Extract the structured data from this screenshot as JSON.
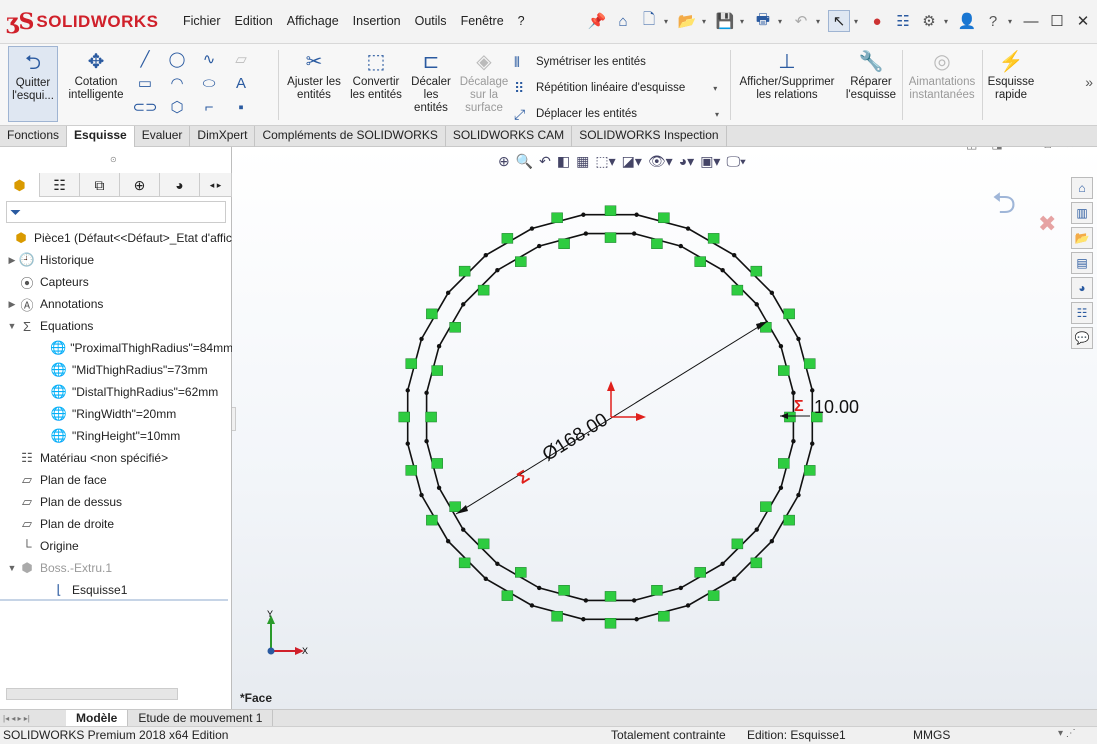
{
  "app": {
    "logo_prefix": "3DS",
    "logo_text": "SOLIDWORKS"
  },
  "menu": [
    "Fichier",
    "Edition",
    "Affichage",
    "Insertion",
    "Outils",
    "Fenêtre",
    "?"
  ],
  "quickbar_icons": [
    "pin-icon",
    "home-icon",
    "new-file-icon",
    "open-icon",
    "save-icon",
    "print-icon",
    "undo-icon",
    "select-icon",
    "traffic-light-icon",
    "options-icon",
    "gear-icon",
    "user-icon",
    "help-icon",
    "minimize-icon",
    "maximize-icon",
    "close-icon"
  ],
  "commands": {
    "quitter": "Quitter l'esqui...",
    "cotation": "Cotation intelligente",
    "ajuster": "Ajuster les entités",
    "convertir": "Convertir les entités",
    "decaler": "Décaler les entités",
    "decalage_surface": "Décalage sur la surface",
    "symetriser": "Symétriser les entités",
    "repetition": "Répétition linéaire d'esquisse",
    "deplacer": "Déplacer les entités",
    "afficher_relations": "Afficher/Supprimer les relations",
    "reparer": "Réparer l'esquisse",
    "aimantations": "Aimantations instantanées",
    "esquisse_rapide": "Esquisse rapide"
  },
  "tabs": [
    "Fonctions",
    "Esquisse",
    "Evaluer",
    "DimXpert",
    "Compléments de SOLIDWORKS",
    "SOLIDWORKS CAM",
    "SOLIDWORKS Inspection"
  ],
  "active_tab": "Esquisse",
  "tree": {
    "root": "Pièce1  (Défaut<<Défaut>_Etat d'affic",
    "historique": "Historique",
    "capteurs": "Capteurs",
    "annotations": "Annotations",
    "equations": "Equations",
    "eq1": "\"ProximalThighRadius\"=84mm",
    "eq2": "\"MidThighRadius\"=73mm",
    "eq3": "\"DistalThighRadius\"=62mm",
    "eq4": "\"RingWidth\"=20mm",
    "eq5": "\"RingHeight\"=10mm",
    "materiau": "Matériau <non spécifié>",
    "plan_face": "Plan de face",
    "plan_dessus": "Plan de dessus",
    "plan_droite": "Plan de droite",
    "origine": "Origine",
    "boss": "Boss.-Extru.1",
    "esquisse": "Esquisse1"
  },
  "viewport": {
    "dim_diameter": "Ø168.00",
    "dim_width": "10.00",
    "sigma": "Σ",
    "axis_x": "X",
    "axis_y": "Y",
    "view_label": "*Face"
  },
  "bottom_tabs": [
    "Modèle",
    "Etude de mouvement 1"
  ],
  "status": {
    "product": "SOLIDWORKS Premium 2018 x64 Edition",
    "constraint": "Totalement contrainte",
    "edition": "Edition: Esquisse1",
    "units": "MMGS"
  },
  "colors": {
    "brand": "#d0202a",
    "sketch_line": "#111111",
    "relation_badge": "#2ecc40",
    "dimension": "#111111",
    "sigma": "#e0201c",
    "accent": "#2a5aa0"
  }
}
